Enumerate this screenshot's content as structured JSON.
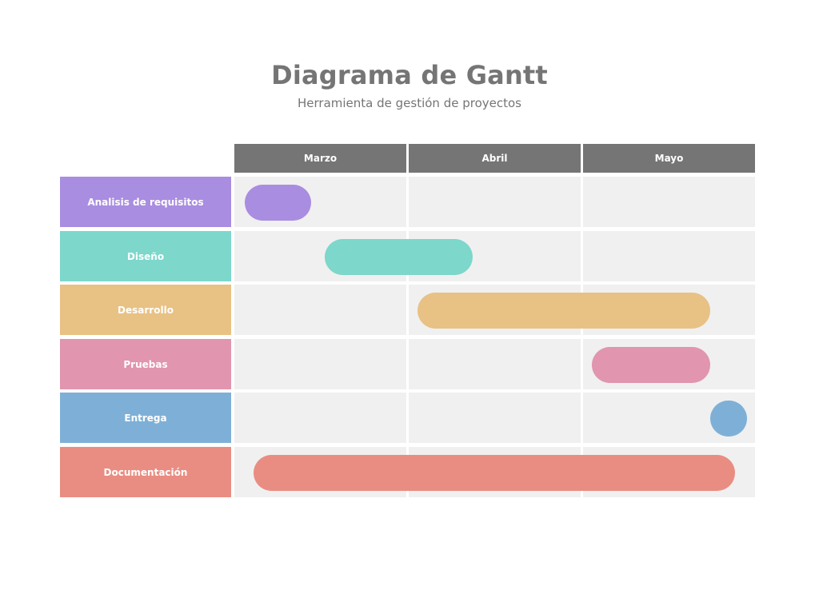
{
  "title": "Diagrama de Gantt",
  "subtitle": "Herramienta de gestión de proyectos",
  "chart_data": {
    "type": "gantt",
    "months": [
      "Marzo",
      "Abril",
      "Mayo"
    ],
    "tasks": [
      {
        "name": "Analisis de requisitos",
        "start": 0.06,
        "end": 0.44,
        "color": "#a98de1"
      },
      {
        "name": "Diseño",
        "start": 0.52,
        "end": 1.37,
        "color": "#7dd7cb"
      },
      {
        "name": "Desarrollo",
        "start": 1.05,
        "end": 2.73,
        "color": "#e8c184"
      },
      {
        "name": "Pruebas",
        "start": 2.05,
        "end": 2.73,
        "color": "#e195ae"
      },
      {
        "name": "Entrega",
        "start": 2.73,
        "end": 2.94,
        "color": "#7eb0d7"
      },
      {
        "name": "Documentación",
        "start": 0.11,
        "end": 2.87,
        "color": "#e98d82"
      }
    ],
    "header_color": "#757575",
    "cell_color": "#f0f0f0"
  }
}
